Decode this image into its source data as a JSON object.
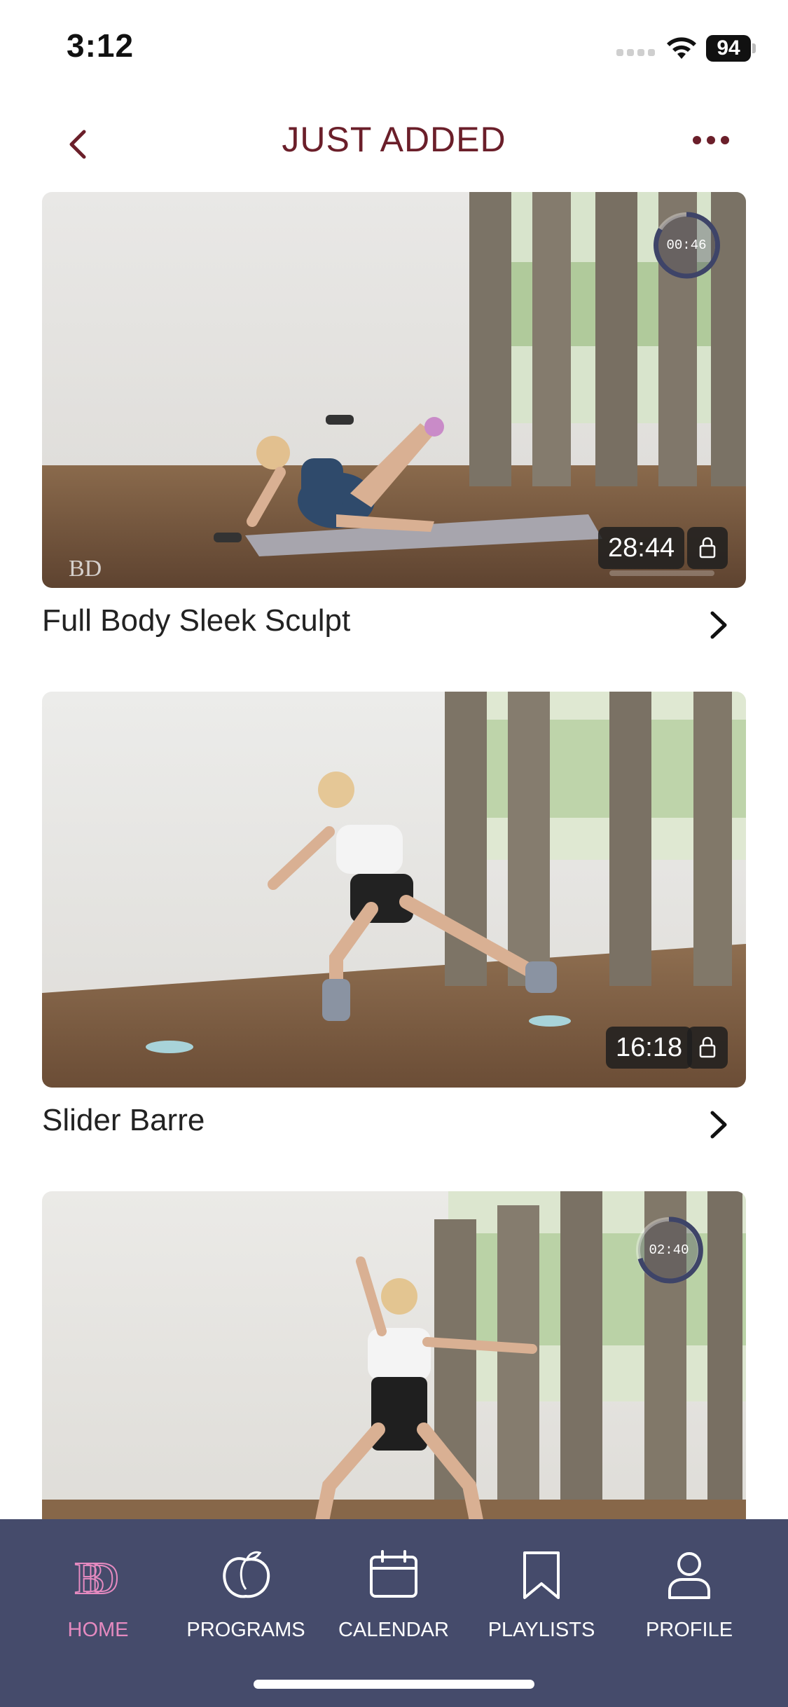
{
  "status_bar": {
    "time": "3:12",
    "battery": "94"
  },
  "header": {
    "title": "JUST ADDED",
    "back_icon": "chevron-left-icon",
    "more_icon": "ellipsis-icon"
  },
  "videos": [
    {
      "title": "Full Body Sleek Sculpt",
      "duration": "28:44",
      "timer": "00:46",
      "locked": true
    },
    {
      "title": "Slider Barre",
      "duration": "16:18",
      "locked": true
    },
    {
      "timer": "02:40"
    }
  ],
  "tabs": [
    {
      "label": "HOME",
      "icon": "logo-bd-icon",
      "active": true
    },
    {
      "label": "PROGRAMS",
      "icon": "peach-icon",
      "active": false
    },
    {
      "label": "CALENDAR",
      "icon": "calendar-icon",
      "active": false
    },
    {
      "label": "PLAYLISTS",
      "icon": "bookmark-icon",
      "active": false
    },
    {
      "label": "PROFILE",
      "icon": "person-icon",
      "active": false
    }
  ],
  "colors": {
    "title": "#6b1f2a",
    "tab_bar": "#454b6b",
    "tab_active": "#e58ac0"
  }
}
